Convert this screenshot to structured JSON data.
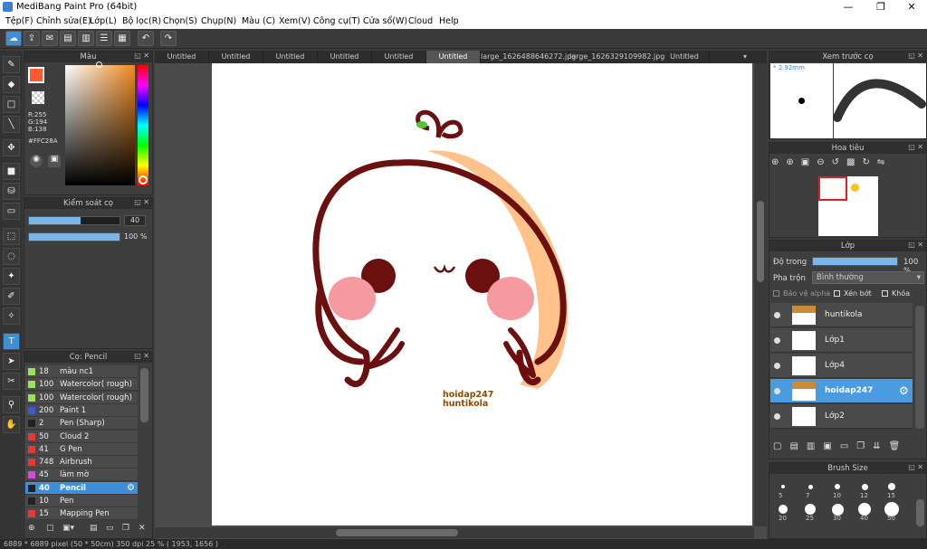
{
  "window": {
    "title": "MediBang Paint Pro (64bit)"
  },
  "menu": [
    "Tệp(F)",
    "Chỉnh sửa(E)",
    "Lớp(L)",
    "Bộ lọc(R)",
    "Chọn(S)",
    "Chụp(N)",
    "Màu (C)",
    "Xem(V)",
    "Công cụ(T)",
    "Cửa sổ(W)",
    "Cloud",
    "Help"
  ],
  "color_panel": {
    "title": "Màu",
    "r": "R:255",
    "g": "G:194",
    "b": "B:138",
    "hex": "#FFC28A",
    "primary": "#FF5B2E",
    "secondary": "#ffffff"
  },
  "brush_control": {
    "title": "Kiểm soát cọ",
    "size": "40",
    "opacity": "100 %",
    "size_fraction": 0.57,
    "opacity_fraction": 1.0
  },
  "brush_list": {
    "title": "Cọ: Pencil",
    "items": [
      {
        "size": "18",
        "name": "màu nc1",
        "color": "#9be15b"
      },
      {
        "size": "100",
        "name": "Watercolor( rough)",
        "color": "#9be15b"
      },
      {
        "size": "100",
        "name": "Watercolor( rough)",
        "color": "#9be15b"
      },
      {
        "size": "200",
        "name": "Paint 1",
        "color": "#3a5bd9"
      },
      {
        "size": "2",
        "name": "Pen (Sharp)",
        "color": "#222"
      },
      {
        "size": "50",
        "name": "Cloud 2",
        "color": "#e03b3b"
      },
      {
        "size": "41",
        "name": "G Pen",
        "color": "#e03b3b"
      },
      {
        "size": "748",
        "name": "Airbrush",
        "color": "#e03b3b"
      },
      {
        "size": "45",
        "name": "làm mờ",
        "color": "#d64bd6"
      },
      {
        "size": "40",
        "name": "Pencil",
        "color": "#222",
        "selected": true
      },
      {
        "size": "10",
        "name": "Pen",
        "color": "#222"
      },
      {
        "size": "15",
        "name": "Mapping Pen",
        "color": "#e03b3b"
      }
    ]
  },
  "tabs": [
    "Untitled",
    "Untitled",
    "Untitled",
    "Untitled",
    "Untitled",
    "Untitled",
    "large_1626488646272.jpg",
    "large_1626329109982.jpg",
    "Untitled"
  ],
  "active_tab": 5,
  "canvas_text": {
    "line1": "hoidap247",
    "line2": "huntikola"
  },
  "preview": {
    "title": "Xem trước cọ",
    "size": "* 2.92mm"
  },
  "navigator": {
    "title": "Hoa tiêu"
  },
  "layers_panel": {
    "title": "Lớp",
    "opacity_label": "Độ trong",
    "opacity_value": "100 %",
    "blend_label": "Pha trộn",
    "blend_value": "Bình thường",
    "protect_alpha": "Bảo vệ alpha",
    "clipping": "Xén bớt",
    "lock": "Khóa"
  },
  "layers": [
    {
      "name": "huntikola"
    },
    {
      "name": "Lớp1"
    },
    {
      "name": "Lớp4"
    },
    {
      "name": "hoidap247",
      "selected": true
    },
    {
      "name": "Lớp2"
    }
  ],
  "brush_size": {
    "title": "Brush Size",
    "row1": [
      "5",
      "7",
      "10",
      "12",
      "15"
    ],
    "row2": [
      "20",
      "25",
      "30",
      "40",
      "50"
    ]
  },
  "status": "6889 * 6889 pixel   (50 * 50cm)   350 dpi   25 %   ( 1953, 1656 )"
}
